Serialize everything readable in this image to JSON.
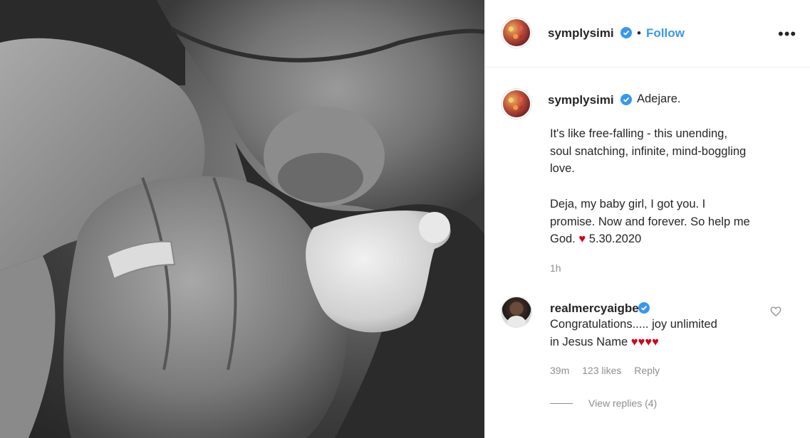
{
  "post": {
    "author": "symplysimi",
    "separator": "•",
    "follow_label": "Follow",
    "more_label": "•••",
    "caption": {
      "first_line": "Adejare.",
      "paragraph1": [
        "It's like free-falling - this unending,",
        "soul snatching, infinite, mind-boggling",
        "love."
      ],
      "paragraph2": [
        "Deja, my baby girl, I got you. I",
        "promise. Now and forever. So help me"
      ],
      "last_line_prefix": "God.",
      "heart": "♥",
      "date": "5.30.2020"
    },
    "time_ago": "1h"
  },
  "comment": {
    "author": "realmercyaigbe",
    "text_line1": "Congratulations..... joy unlimited",
    "text_line2_prefix": "in Jesus Name",
    "hearts": "♥♥♥♥",
    "time": "39m",
    "likes": "123 likes",
    "reply_label": "Reply",
    "view_replies": "View replies (4)"
  },
  "colors": {
    "link_blue": "#3897f0",
    "verified_blue": "#3897f0",
    "heart_red": "#d0021b",
    "meta_gray": "#8e8e8e"
  },
  "icons": {
    "verified": "verified-badge-icon",
    "like": "heart-outline-icon",
    "more": "more-options-icon"
  }
}
